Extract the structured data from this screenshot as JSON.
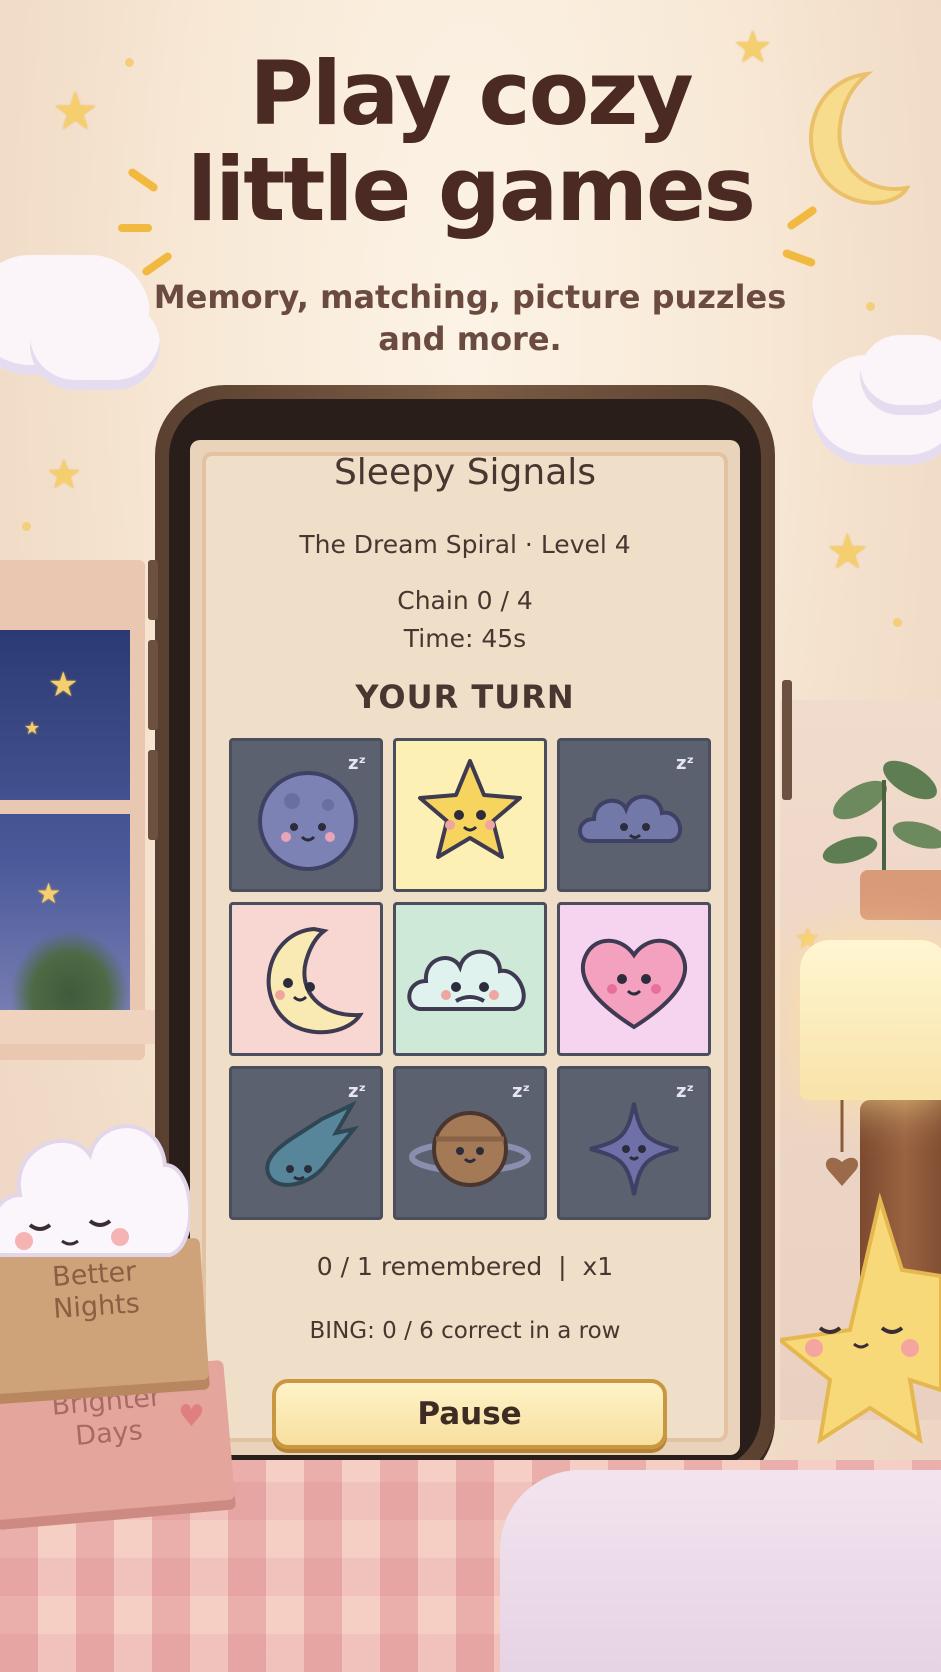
{
  "headline": {
    "line1": "Play cozy",
    "line2": "little games",
    "subtitle_line1": "Memory, matching, picture puzzles",
    "subtitle_line2": "and more."
  },
  "game": {
    "title": "Sleepy Signals",
    "level_label": "The Dream Spiral · Level 4",
    "chain": "Chain 0 / 4",
    "time": "Time: 45s",
    "turn": "YOUR TURN",
    "sleep_marker": "zᶻ",
    "tiles": [
      {
        "icon": "moon-ball-icon",
        "state": "asleep",
        "color": "#5c6170"
      },
      {
        "icon": "star-icon",
        "state": "awake",
        "color": "#fdf0b4"
      },
      {
        "icon": "cloud-icon",
        "state": "asleep",
        "color": "#5c6170"
      },
      {
        "icon": "crescent-moon-icon",
        "state": "awake",
        "color": "#f8d6d2"
      },
      {
        "icon": "fluffy-cloud-icon",
        "state": "awake",
        "color": "#cfe9d8"
      },
      {
        "icon": "heart-icon",
        "state": "awake",
        "color": "#f6d3ef"
      },
      {
        "icon": "comet-icon",
        "state": "asleep",
        "color": "#5c6170"
      },
      {
        "icon": "planet-icon",
        "state": "asleep",
        "color": "#5c6170"
      },
      {
        "icon": "sparkle-star-icon",
        "state": "asleep",
        "color": "#5c6170"
      }
    ],
    "remembered": "0 / 1 remembered  |  x1",
    "bing": "BING: 0 / 6 correct in a row",
    "pause_label": "Pause"
  },
  "decor": {
    "book_top": "Better Nights",
    "book_top_line1": "Better",
    "book_top_line2": "Nights",
    "book_bottom_line1": "Brighter",
    "book_bottom_line2": "Days"
  },
  "colors": {
    "headline": "#4a2a22",
    "accent_gold": "#f1b93f",
    "button_bg": "#fbe8b4"
  }
}
